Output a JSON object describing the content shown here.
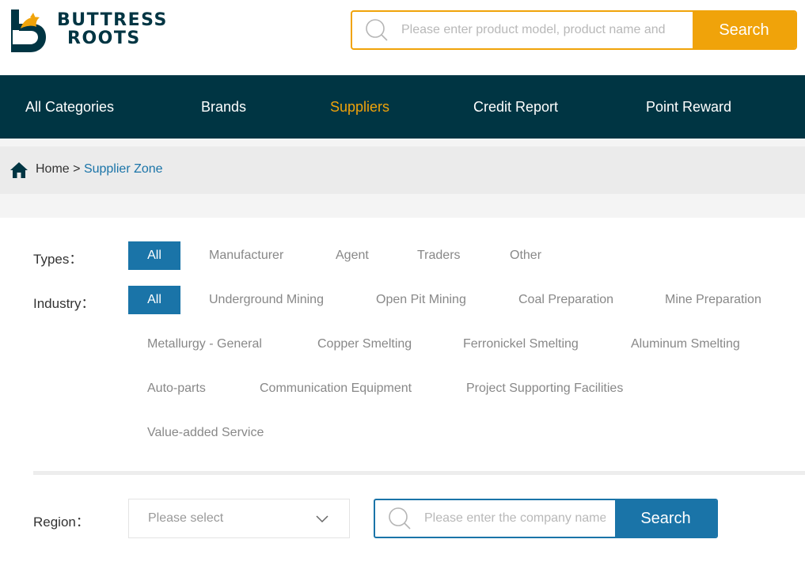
{
  "brand": {
    "line1": "BUTTRESS",
    "line2": "ROOTS",
    "colors": {
      "primary": "#003543",
      "accent": "#f0a30a",
      "link": "#1a74a8"
    }
  },
  "top_search": {
    "placeholder": "Please enter product model, product name and",
    "button_label": "Search",
    "icon": "search-icon"
  },
  "nav": {
    "items": [
      {
        "label": "All Categories"
      },
      {
        "label": "Brands"
      },
      {
        "label": "Suppliers",
        "active": true
      },
      {
        "label": "Credit Report"
      },
      {
        "label": "Point Reward"
      }
    ]
  },
  "breadcrumb": {
    "icon": "home-icon",
    "home": "Home",
    "separator": ">",
    "current": "Supplier Zone"
  },
  "filters": {
    "types": {
      "label": "Types：",
      "options": [
        "All",
        "Manufacturer",
        "Agent",
        "Traders",
        "Other"
      ],
      "selected": "All"
    },
    "industry": {
      "label": "Industry：",
      "options": [
        "All",
        "Underground Mining",
        "Open Pit Mining",
        "Coal Preparation",
        "Mine Preparation",
        "Metallurgy - General",
        "Copper Smelting",
        "Ferronickel Smelting",
        "Aluminum Smelting",
        "Auto-parts",
        "Communication Equipment",
        "Project Supporting Facilities",
        "Value-added Service"
      ],
      "selected": "All"
    },
    "region": {
      "label": "Region：",
      "placeholder": "Please select"
    }
  },
  "company_search": {
    "placeholder": "Please enter the company name",
    "button_label": "Search",
    "icon": "search-icon"
  }
}
